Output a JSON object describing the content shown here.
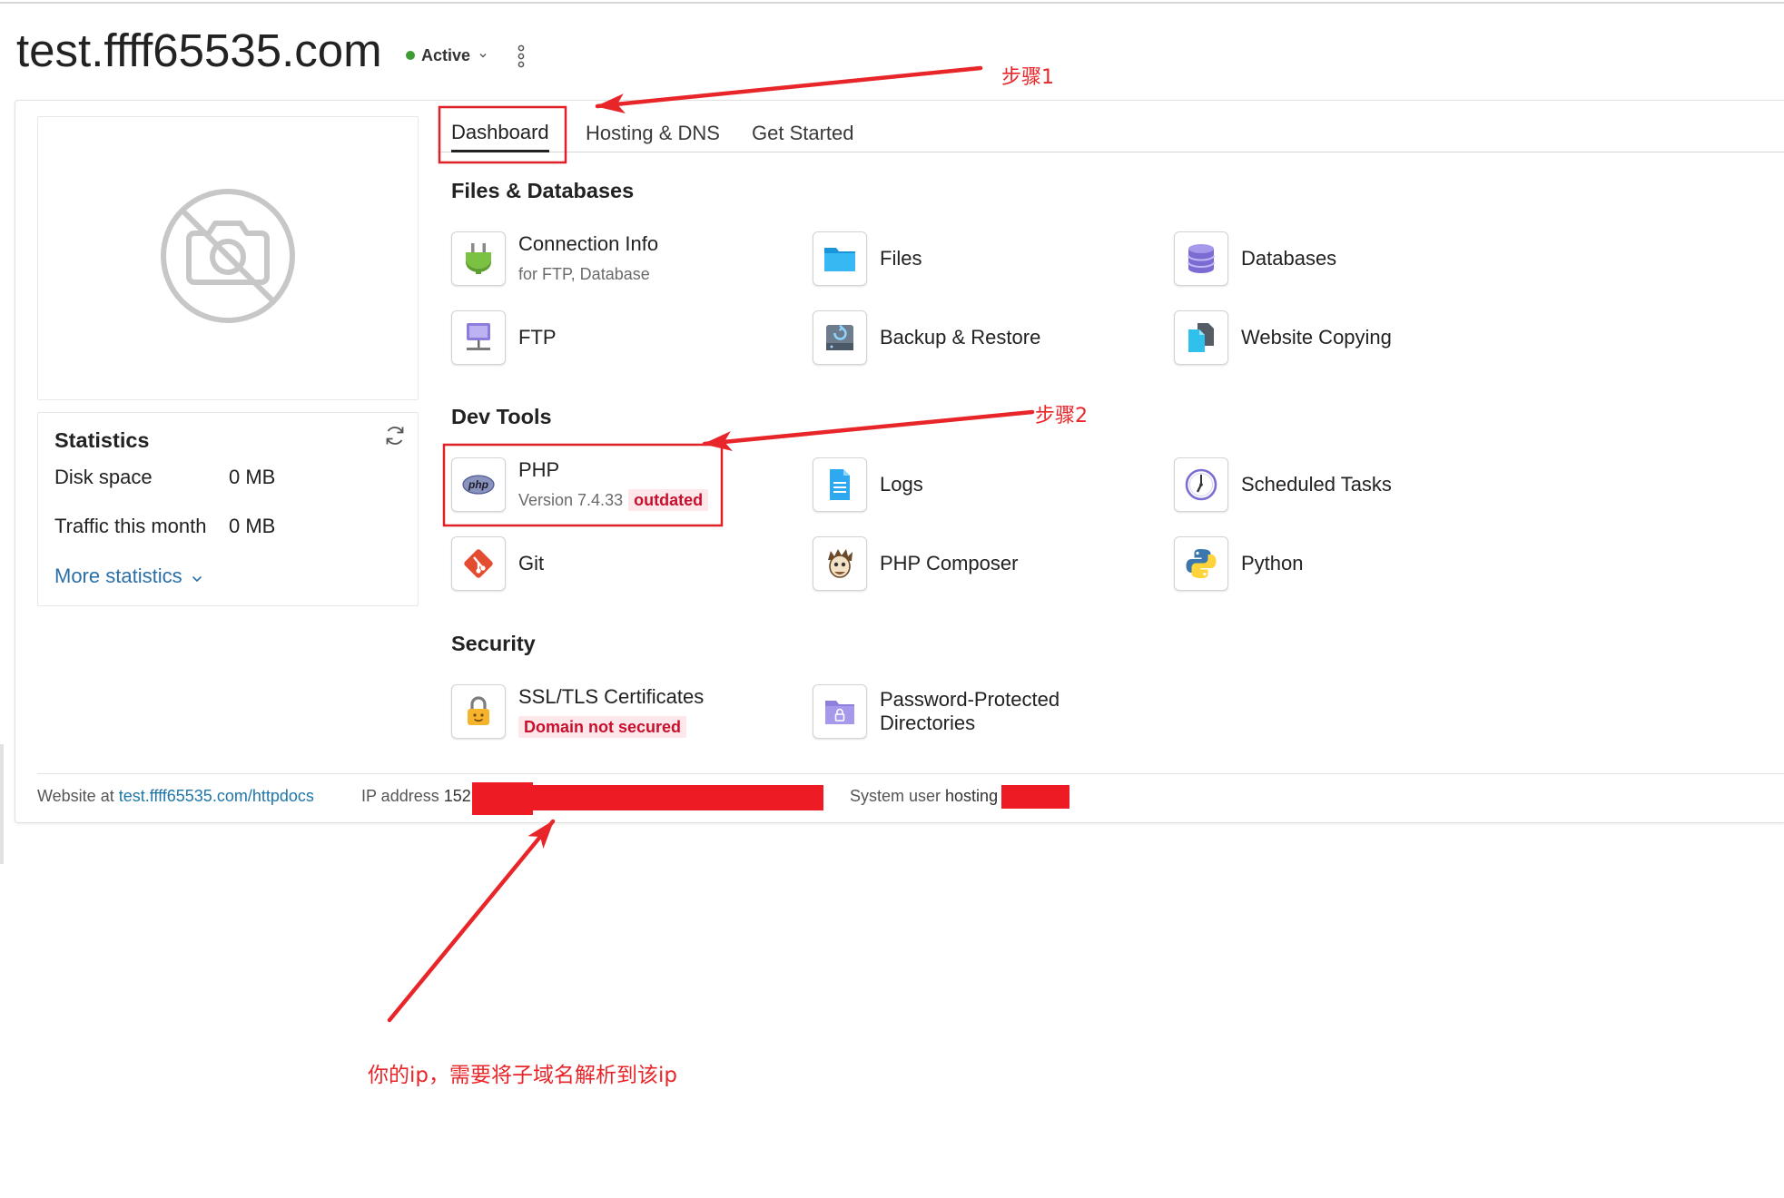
{
  "header": {
    "domain_title": "test.ffff65535.com",
    "status": "Active",
    "status_color": "#3e9c35",
    "status_icon": "chevron-down-icon",
    "menu_icon": "kebab-menu-icon"
  },
  "preview": {
    "icon": "no-photo-camera-icon"
  },
  "statistics": {
    "title": "Statistics",
    "refresh_icon": "refresh-icon",
    "rows": [
      {
        "label": "Disk space",
        "value": "0 MB"
      },
      {
        "label": "Traffic this month",
        "value": "0 MB"
      }
    ],
    "more_link": "More statistics"
  },
  "tabs": [
    {
      "label": "Dashboard",
      "active": true
    },
    {
      "label": "Hosting & DNS",
      "active": false
    },
    {
      "label": "Get Started",
      "active": false
    }
  ],
  "sections": [
    {
      "title": "Files & Databases",
      "items": [
        {
          "label": "Connection Info",
          "sub": "for FTP, Database",
          "icon": "plug-icon"
        },
        {
          "label": "Files",
          "icon": "folder-icon"
        },
        {
          "label": "Databases",
          "icon": "database-icon"
        },
        {
          "label": "FTP",
          "icon": "ftp-server-icon"
        },
        {
          "label": "Backup & Restore",
          "icon": "backup-drive-icon"
        },
        {
          "label": "Website Copying",
          "icon": "copy-files-icon"
        }
      ]
    },
    {
      "title": "Dev Tools",
      "items": [
        {
          "label": "PHP",
          "sub": "Version 7.4.33",
          "badge": "outdated",
          "icon": "php-icon"
        },
        {
          "label": "Logs",
          "icon": "log-file-icon"
        },
        {
          "label": "Scheduled Tasks",
          "icon": "clock-icon"
        },
        {
          "label": "Git",
          "icon": "git-icon"
        },
        {
          "label": "PHP Composer",
          "icon": "composer-icon"
        },
        {
          "label": "Python",
          "icon": "python-icon"
        }
      ]
    },
    {
      "title": "Security",
      "items": [
        {
          "label": "SSL/TLS Certificates",
          "badge": "Domain not secured",
          "icon": "padlock-icon"
        },
        {
          "label": "Password-Protected Directories",
          "icon": "locked-folder-icon"
        }
      ]
    }
  ],
  "icons": {
    "php_logo_text": "php"
  },
  "footer": {
    "website_prefix": "Website at",
    "website_link": "test.ffff65535.com/httpdocs",
    "ip_label": "IP address",
    "ip_visible": "152",
    "system_user_label": "System user",
    "system_user_visible": "hosting"
  },
  "annotations": {
    "step1": "步骤1",
    "step2": "步骤2",
    "ip_note": "你的ip，需要将子域名解析到该ip",
    "color": "#e8262a"
  },
  "colors": {
    "link": "#1f76a8",
    "warning_text": "#c8102e",
    "warning_bg": "#fde7ea"
  }
}
